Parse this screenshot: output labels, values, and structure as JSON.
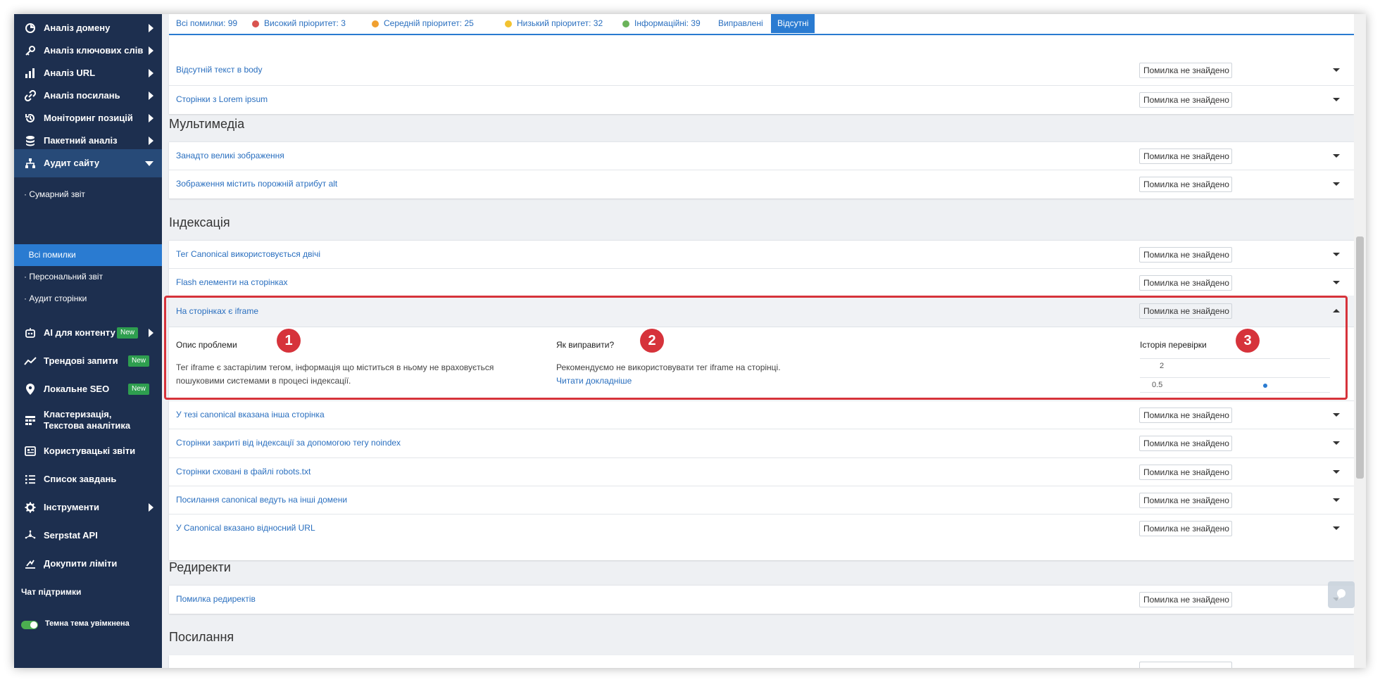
{
  "sidebar": {
    "items": [
      {
        "label": "Аналіз домену",
        "icon": "domain-analysis-icon"
      },
      {
        "label": "Аналіз ключових слів",
        "icon": "key-icon"
      },
      {
        "label": "Аналіз URL",
        "icon": "bar-chart-icon"
      },
      {
        "label": "Аналіз посилань",
        "icon": "link-icon"
      },
      {
        "label": "Моніторинг позицій",
        "icon": "history-icon"
      },
      {
        "label": "Пакетний аналіз",
        "icon": "database-icon"
      },
      {
        "label": "Аудит сайту",
        "icon": "sitemap-icon"
      }
    ],
    "sub_items": [
      "Сумарний звіт",
      "Всі помилки",
      "Персональний звіт",
      "Аудит сторінки"
    ],
    "items2": [
      {
        "label": "AI для контенту",
        "icon": "robot-icon",
        "badge": "New"
      },
      {
        "label": "Трендові запити",
        "icon": "trend-icon",
        "badge": "New"
      },
      {
        "label": "Локальне SEO",
        "icon": "map-pin-icon",
        "badge": "New"
      },
      {
        "label": "Кластеризація,",
        "label2": "Текстова аналітика",
        "icon": "cluster-icon"
      },
      {
        "label": "Користувацькі звіти",
        "icon": "report-icon"
      },
      {
        "label": "Список завдань",
        "icon": "task-list-icon"
      },
      {
        "label": "Інструменти",
        "icon": "gear-icon"
      },
      {
        "label": "Serpstat API",
        "icon": "api-icon"
      },
      {
        "label": "Докупити ліміти",
        "icon": "limits-icon"
      }
    ],
    "chat": "Чат підтримки",
    "theme_toggle": "Темна тема увімкнена"
  },
  "filters": {
    "all": "Всі помилки: 99",
    "high": "Високий пріоритет: 3",
    "medium": "Середній пріоритет: 25",
    "low": "Низький пріоритет: 32",
    "info": "Інформаційні: 39",
    "fixed": "Виправлені",
    "missing": "Відсутні",
    "colors": {
      "high": "#d9534f",
      "medium": "#f0a030",
      "low": "#f2c230",
      "info": "#6bb35a"
    }
  },
  "status_text": "Помилка не знайдено",
  "group0": {
    "rows": [
      "Відсутній текст в body",
      "Сторінки з Lorem ipsum"
    ]
  },
  "section_multimedia": {
    "title": "Мультимедіа",
    "rows": [
      "Занадто великі зображення",
      "Зображення містить порожній атрибут alt"
    ]
  },
  "section_indexing": {
    "title": "Індексація",
    "rows": [
      "Тег Canonical використовується двічі",
      "Flash елементи на сторінках"
    ],
    "rows_after": [
      "У тезі canonical вказана інша сторінка",
      "Сторінки закриті від індексації за допомогою тегу noindex",
      "Сторінки сховані в файлі robots.txt",
      "Посилання canonical ведуть на інші домени",
      "У Canonical вказано відносний URL"
    ]
  },
  "expanded": {
    "title": "На сторінках є iframe",
    "problem_heading": "Опис проблеми",
    "problem_line1": "Тег iframe є застарілим тегом, інформація що міститься в ньому не враховується",
    "problem_line2": "пошуковими системами в процесі індексації.",
    "fix_heading": "Як виправити?",
    "fix_text": "Рекомендуємо не використовувати тег iframe на сторінці.",
    "fix_link": "Читати докладніше",
    "history_heading": "Історія перевірки",
    "history_ticks": [
      "2",
      "0.5"
    ],
    "numbers": [
      "1",
      "2",
      "3"
    ]
  },
  "section_redirects": {
    "title": "Редиректи",
    "rows": [
      "Помилка редиректів"
    ]
  },
  "section_links": {
    "title": "Посилання"
  },
  "colors": {
    "sidebar_bg": "#1d2f4f",
    "accent": "#2a7bd1",
    "link": "#2a6fbf",
    "highlight": "#d6333b",
    "badge": "#2e9e4f"
  }
}
